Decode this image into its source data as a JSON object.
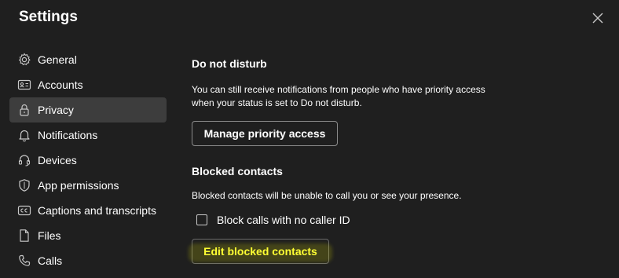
{
  "window": {
    "title": "Settings",
    "close_icon": "close-icon"
  },
  "sidebar": {
    "items": [
      {
        "label": "General",
        "icon": "gear-icon",
        "active": false
      },
      {
        "label": "Accounts",
        "icon": "id-card-icon",
        "active": false
      },
      {
        "label": "Privacy",
        "icon": "lock-icon",
        "active": true
      },
      {
        "label": "Notifications",
        "icon": "bell-icon",
        "active": false
      },
      {
        "label": "Devices",
        "icon": "headset-icon",
        "active": false
      },
      {
        "label": "App permissions",
        "icon": "shield-icon",
        "active": false
      },
      {
        "label": "Captions and transcripts",
        "icon": "captions-icon",
        "active": false
      },
      {
        "label": "Files",
        "icon": "file-icon",
        "active": false
      },
      {
        "label": "Calls",
        "icon": "phone-icon",
        "active": false
      }
    ]
  },
  "privacy": {
    "dnd_title": "Do not disturb",
    "dnd_desc": "You can still receive notifications from people who have priority access when your status is set to Do not disturb.",
    "manage_priority_label": "Manage priority access",
    "blocked_title": "Blocked contacts",
    "blocked_desc": "Blocked contacts will be unable to call you or see your presence.",
    "block_no_caller_label": "Block calls with no caller ID",
    "block_no_caller_checked": false,
    "edit_blocked_label": "Edit blocked contacts"
  },
  "colors": {
    "background": "#1f1f1f",
    "active_item": "#3d3d3d",
    "highlight": "#ffff33"
  }
}
